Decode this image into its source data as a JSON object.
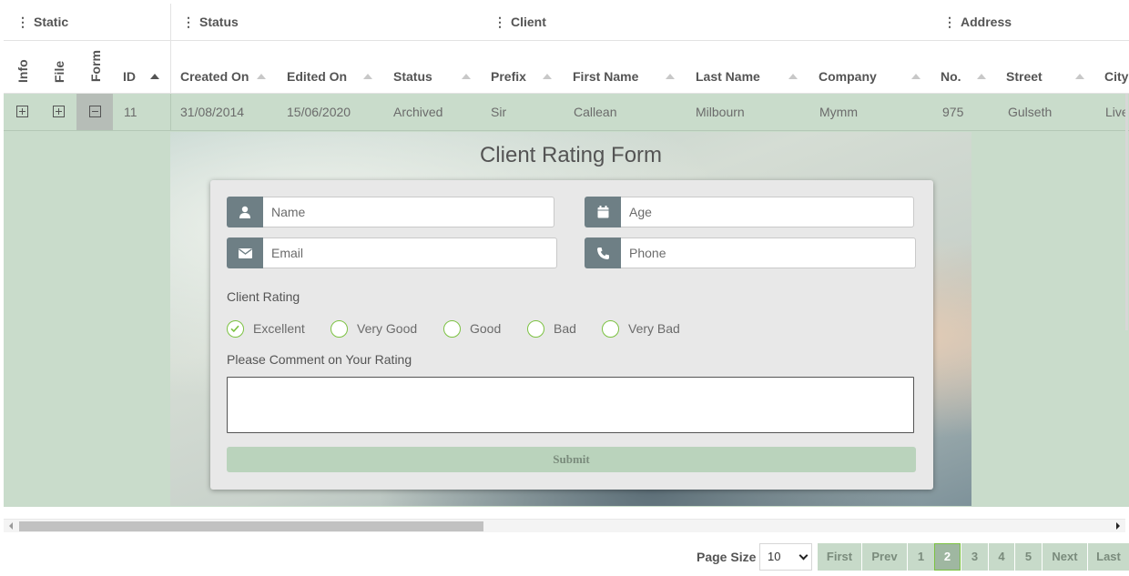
{
  "groups": {
    "static": "Static",
    "status": "Status",
    "client": "Client",
    "address": "Address"
  },
  "columns": {
    "info": "Info",
    "file": "File",
    "form": "Form",
    "id": "ID",
    "created_on": "Created On",
    "edited_on": "Edited On",
    "status": "Status",
    "prefix": "Prefix",
    "first_name": "First Name",
    "last_name": "Last Name",
    "company": "Company",
    "no": "No.",
    "street": "Street",
    "city": "City"
  },
  "row": {
    "id": "11",
    "created_on": "31/08/2014",
    "edited_on": "15/06/2020",
    "status": "Archived",
    "prefix": "Sir",
    "first_name": "Callean",
    "last_name": "Milbourn",
    "company": "Mymm",
    "no": "975",
    "street": "Gulseth",
    "city": "Live"
  },
  "form": {
    "title": "Client Rating Form",
    "name_placeholder": "Name",
    "age_placeholder": "Age",
    "email_placeholder": "Email",
    "phone_placeholder": "Phone",
    "rating_label": "Client Rating",
    "options": [
      "Excellent",
      "Very Good",
      "Good",
      "Bad",
      "Very Bad"
    ],
    "selected": "Excellent",
    "comment_label": "Please Comment on Your Rating",
    "submit_label": "Submit"
  },
  "pager": {
    "page_size_label": "Page Size",
    "page_size_value": "10",
    "first": "First",
    "prev": "Prev",
    "pages": [
      "1",
      "2",
      "3",
      "4",
      "5"
    ],
    "current_page": "2",
    "next": "Next",
    "last": "Last"
  },
  "colors": {
    "row_bg": "#c9dccb",
    "accent_green": "#7cc242",
    "icon_bg": "#6e7f85"
  }
}
